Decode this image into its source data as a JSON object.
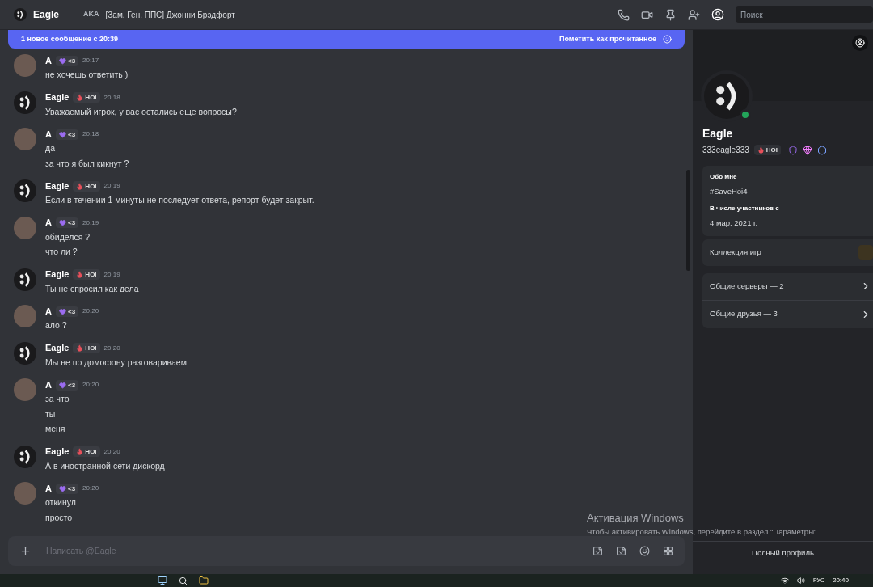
{
  "header": {
    "name": "Eagle",
    "tag": "AKA",
    "nickname": "[Зам. Ген. ППС] Джонни Брэдфорт",
    "search": {
      "placeholder": "Поиск"
    }
  },
  "new_messages_bar": {
    "text": "1 новое сообщение с 20:39",
    "action": "Пометить как прочитанное"
  },
  "messages": [
    {
      "author": "A",
      "kind": "photo",
      "badge": {
        "text": "<3",
        "color": "#9b6cf0"
      },
      "time": "20:17",
      "lines": [
        "не хочешь ответить )"
      ]
    },
    {
      "author": "Eagle",
      "kind": "smiley",
      "badge": {
        "text": "HOI",
        "color": "#e8505b"
      },
      "time": "20:18",
      "lines": [
        "Уважаемый игрок, у вас остались еще вопросы?"
      ]
    },
    {
      "author": "A",
      "kind": "photo",
      "badge": {
        "text": "<3",
        "color": "#9b6cf0"
      },
      "time": "20:18",
      "lines": [
        "да",
        "за что я был кикнут ?"
      ]
    },
    {
      "author": "Eagle",
      "kind": "smiley",
      "badge": {
        "text": "HOI",
        "color": "#e8505b"
      },
      "time": "20:19",
      "lines": [
        "Если в течении 1 минуты не последует ответа, репорт будет закрыт."
      ]
    },
    {
      "author": "A",
      "kind": "photo",
      "badge": {
        "text": "<3",
        "color": "#9b6cf0"
      },
      "time": "20:19",
      "lines": [
        "обиделся ?",
        "что ли ?"
      ]
    },
    {
      "author": "Eagle",
      "kind": "smiley",
      "badge": {
        "text": "HOI",
        "color": "#e8505b"
      },
      "time": "20:19",
      "lines": [
        "Ты не спросил как дела"
      ]
    },
    {
      "author": "A",
      "kind": "photo",
      "badge": {
        "text": "<3",
        "color": "#9b6cf0"
      },
      "time": "20:20",
      "lines": [
        "ало ?"
      ]
    },
    {
      "author": "Eagle",
      "kind": "smiley",
      "badge": {
        "text": "HOI",
        "color": "#e8505b"
      },
      "time": "20:20",
      "lines": [
        "Мы не по домофону разговариваем"
      ]
    },
    {
      "author": "A",
      "kind": "photo",
      "badge": {
        "text": "<3",
        "color": "#9b6cf0"
      },
      "time": "20:20",
      "lines": [
        "за что",
        "ты",
        "меня"
      ]
    },
    {
      "author": "Eagle",
      "kind": "smiley",
      "badge": {
        "text": "HOI",
        "color": "#e8505b"
      },
      "time": "20:20",
      "lines": [
        "А в иностранной сети дискорд"
      ]
    },
    {
      "author": "A",
      "kind": "photo",
      "badge": {
        "text": "<3",
        "color": "#9b6cf0"
      },
      "time": "20:20",
      "lines": [
        "откинул",
        "просто"
      ]
    }
  ],
  "composer": {
    "placeholder": "Написать @Eagle"
  },
  "profile": {
    "name": "Eagle",
    "username": "333eagle333",
    "badge": {
      "text": "HOI",
      "color": "#e8505b"
    },
    "online": true,
    "about_heading": "Обо мне",
    "about": "#SaveHoi4",
    "member_since_heading": "В числе участников с",
    "member_since": "4 мар. 2021 г.",
    "game_collection": "Коллекция игр",
    "mutual": [
      "Общие серверы — 2",
      "Общие друзья — 3"
    ],
    "full_profile": "Полный профиль"
  },
  "os_notice": {
    "title": "Активация Windows",
    "text": "Чтобы активировать Windows, перейдите в раздел \"Параметры\"."
  },
  "taskbar": {
    "language": "РУС",
    "time": "20:40"
  }
}
